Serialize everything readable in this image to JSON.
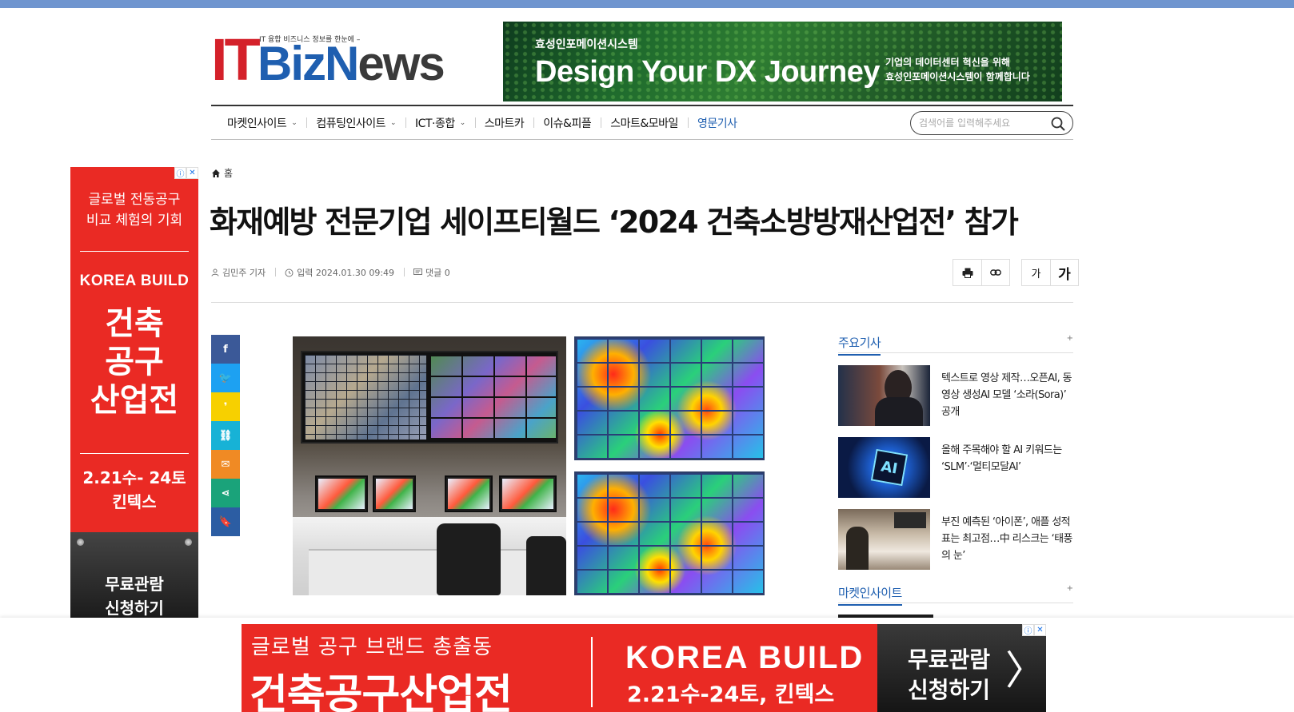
{
  "header": {
    "logo_tagline": "IT 융합 비즈니스 정보를 한눈에 –",
    "logo_it": "IT",
    "logo_biz": "Biz",
    "logo_n": "N",
    "logo_ews": "ews"
  },
  "top_banner": {
    "company": "효성인포메이션시스템",
    "headline": "Design Your DX Journey",
    "line1": "기업의 데이터센터 혁신을 위해",
    "line2": "효성인포메이션시스템이 함께합니다"
  },
  "nav": {
    "items": [
      {
        "label": "마켓인사이트",
        "dropdown": "⌄"
      },
      {
        "label": "컴퓨팅인사이트",
        "dropdown": "⌄"
      },
      {
        "label": "ICT·종합",
        "dropdown": "⌄"
      },
      {
        "label": "스마트카",
        "dropdown": ""
      },
      {
        "label": "이슈&피플",
        "dropdown": ""
      },
      {
        "label": "스마트&모바일",
        "dropdown": ""
      },
      {
        "label": "영문기사",
        "dropdown": ""
      }
    ],
    "search_placeholder": "검색어를 입력해주세요"
  },
  "left_ad": {
    "info_icon": "ⓘ",
    "close_icon": "✕",
    "line1": "글로벌 전동공구",
    "line2": "비교 체험의 기회",
    "brand": "KOREA BUILD",
    "big1": "건축",
    "big2": "공구",
    "big3": "산업전",
    "date": "2.21수- 24토",
    "venue": "킨텍스",
    "cta1": "무료관람",
    "cta2": "신청하기"
  },
  "article": {
    "breadcrumb_home": "홈",
    "title": "화재예방 전문기업 세이프티월드 ‘2024 건축소방방재산업전’ 참가",
    "author": "김민주 기자",
    "date": "입력 2024.01.30 09:49",
    "comments": "댓글 0",
    "font_small": "가",
    "font_large": "가"
  },
  "share": [
    {
      "name": "facebook-share-button",
      "glyph": "f",
      "color": "#3b5998"
    },
    {
      "name": "twitter-share-button",
      "glyph": "🐦",
      "color": "#1da1f2"
    },
    {
      "name": "kakaostory-share-button",
      "glyph": "❜",
      "color": "#f7d000"
    },
    {
      "name": "link-share-button",
      "glyph": "⛓",
      "color": "#17b2d6"
    },
    {
      "name": "email-share-button",
      "glyph": "✉",
      "color": "#f08a24"
    },
    {
      "name": "share-icon-button",
      "glyph": "⋖",
      "color": "#1aa37a"
    },
    {
      "name": "bookmark-button",
      "glyph": "🔖",
      "color": "#2c5da3"
    }
  ],
  "sidebar": {
    "section1": "주요기사",
    "more": "+",
    "items": [
      {
        "text": "텍스트로 영상 제작…오픈AI, 동영상 생성AI 모델 ‘소라(Sora)’ 공개"
      },
      {
        "text": "올해 주목해야 할 AI 키워드는 ‘SLM’·‘멀티모달AI’"
      },
      {
        "text": "부진 예측된 ‘아이폰’, 애플 성적표는 최고점…中 리스크는 ‘태풍의 눈’"
      }
    ],
    "section2": "마켓인사이트"
  },
  "bottom_ad": {
    "line1": "글로벌 공구 브랜드 총출동",
    "line2": "건축공구산업전",
    "brand": "KOREA BUILD",
    "date": "2.21수-24토, 킨텍스",
    "cta1": "무료관람",
    "cta2": "신청하기",
    "arrow": "〉"
  }
}
